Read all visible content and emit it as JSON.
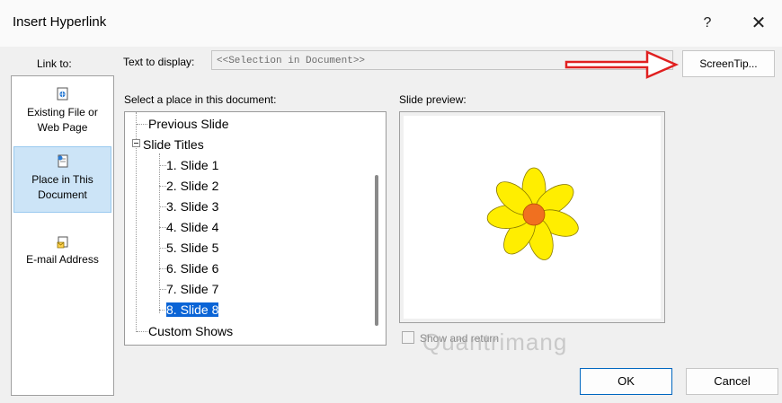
{
  "window": {
    "title": "Insert Hyperlink",
    "help_glyph": "?",
    "close_glyph": "✕"
  },
  "link_to": {
    "label": "Link to:",
    "items": [
      {
        "label_line1": "Existing File or",
        "label_line2": "Web Page",
        "icon": "web-file-icon",
        "selected": false
      },
      {
        "label_line1": "Place in This",
        "label_line2": "Document",
        "icon": "document-place-icon",
        "selected": true
      },
      {
        "label_line1": "E-mail Address",
        "label_line2": "",
        "icon": "email-icon",
        "selected": false
      }
    ]
  },
  "text_to_display": {
    "label": "Text to display:",
    "value": "<<Selection in Document>>"
  },
  "screentip": {
    "label": "ScreenTip..."
  },
  "place": {
    "label": "Select a place in this document:",
    "items": [
      {
        "label": "Previous Slide",
        "level": 0
      },
      {
        "label": "Slide Titles",
        "level": 0,
        "expanded": true
      },
      {
        "label": "1. Slide 1",
        "level": 1
      },
      {
        "label": "2. Slide 2",
        "level": 1
      },
      {
        "label": "3. Slide 3",
        "level": 1
      },
      {
        "label": "4. Slide 4",
        "level": 1
      },
      {
        "label": "5. Slide 5",
        "level": 1
      },
      {
        "label": "6. Slide 6",
        "level": 1
      },
      {
        "label": "7. Slide 7",
        "level": 1
      },
      {
        "label": "8. Slide 8",
        "level": 1,
        "selected": true
      },
      {
        "label": "Custom Shows",
        "level": 0
      }
    ]
  },
  "preview": {
    "label": "Slide preview:"
  },
  "show_and_return": {
    "label": "Show and return",
    "checked": false
  },
  "watermark": "Quantrimang",
  "buttons": {
    "ok": "OK",
    "cancel": "Cancel"
  },
  "colors": {
    "selection": "#0a64d6",
    "flower_petal": "#ffee00",
    "flower_center": "#f07020",
    "arrow": "#e02020"
  }
}
